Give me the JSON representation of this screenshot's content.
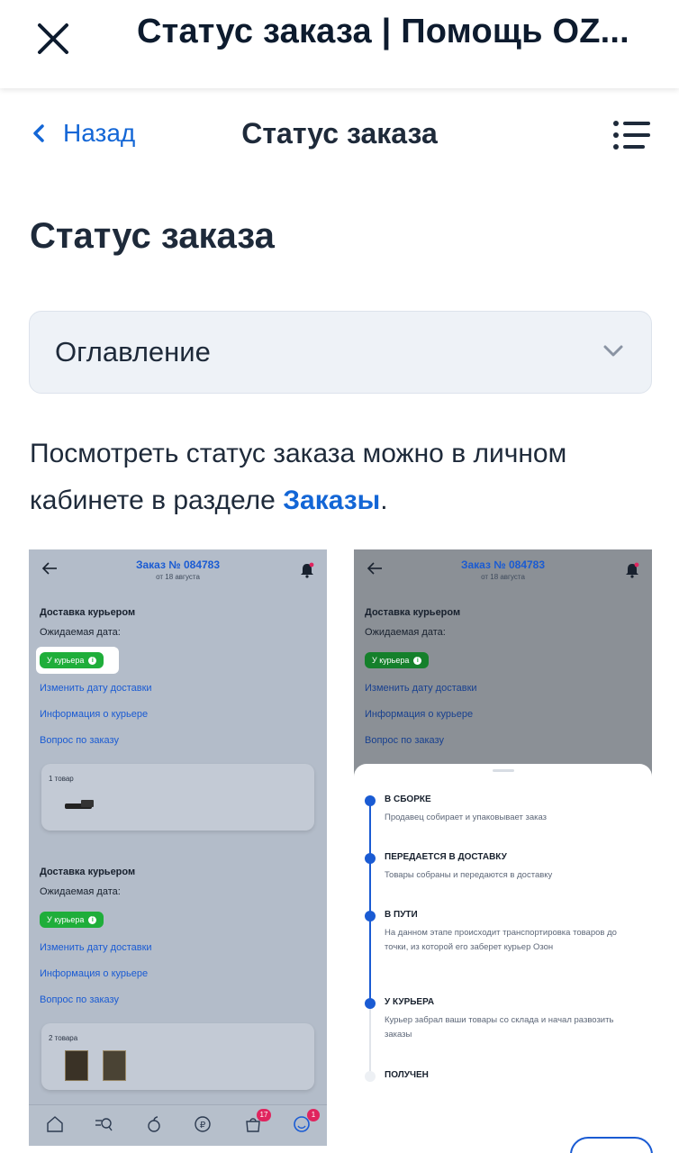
{
  "appbar": {
    "title": "Статус заказа | Помощь OZ..."
  },
  "nav": {
    "back_label": "Назад",
    "title": "Статус заказа"
  },
  "heading": "Статус заказа",
  "toc": {
    "label": "Оглавление"
  },
  "paragraph": {
    "text": "Посмотреть статус заказа можно в личном кабинете в разделе ",
    "link": "Заказы",
    "tail": "."
  },
  "screenshot": {
    "order_title": "Заказ № 084783",
    "order_date": "от 18 августа",
    "delivery_label": "Доставка курьером",
    "expected_date_label": "Ожидаемая дата:",
    "badge": "У курьера",
    "links": [
      "Изменить дату доставки",
      "Информация о курьере",
      "Вопрос по заказу"
    ],
    "card1_label": "1 товар",
    "card2_label": "2 товара",
    "tab_badges": [
      "17",
      "1"
    ],
    "accent": "#1a5bd3",
    "badge_color": "#1fae3a",
    "statuses": [
      {
        "title": "В СБОРКЕ",
        "desc": "Продавец собирает и упаковывает заказ"
      },
      {
        "title": "ПЕРЕДАЕТСЯ В ДОСТАВКУ",
        "desc": "Товары собраны и передаются в доставку"
      },
      {
        "title": "В ПУТИ",
        "desc": "На данном этапе происходит транспортировка товаров до точки, из которой его заберет курьер Озон"
      },
      {
        "title": "У КУРЬЕРА",
        "desc": "Курьер забрал ваши товары со склада и начал развозить заказы"
      },
      {
        "title": "ПОЛУЧЕН",
        "desc": ""
      }
    ]
  }
}
